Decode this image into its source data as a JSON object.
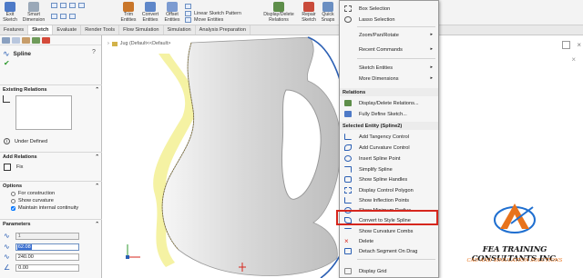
{
  "ribbon": {
    "buttons": [
      "Exit\nSketch",
      "Smart\nDimension",
      "Trim\nEntities",
      "Convert\nEntities",
      "Offset\nEntities",
      "Display/Delete\nRelations",
      "Repair\nSketch",
      "Quick\nSnaps"
    ],
    "pattern_label": "Linear Sketch Pattern",
    "move_label": "Move Entities"
  },
  "tabs": [
    "Features",
    "Sketch",
    "Evaluate",
    "Render Tools",
    "Flow Simulation",
    "Simulation",
    "Analysis Preparation"
  ],
  "active_tab": "Sketch",
  "panel": {
    "title": "Spline",
    "existing_relations": "Existing Relations",
    "under_defined": "Under Defined",
    "add_relations": "Add Relations",
    "fix": "Fix",
    "options": "Options",
    "opt_construction": "For construction",
    "opt_curvature": "Show curvature",
    "opt_continuity": "Maintain internal continuity",
    "parameters": "Parameters",
    "param_1": "1",
    "param_2": "62.08",
    "param_3": "240.00",
    "param_4": "0.00"
  },
  "canvas": {
    "breadcrumb": "Jug (Default<<Default>"
  },
  "menu": {
    "items_top": [
      {
        "label": "Box Selection",
        "submenu": false
      },
      {
        "label": "Lasso Selection",
        "submenu": false
      },
      {
        "label": "Zoom/Pan/Rotate",
        "submenu": true
      },
      {
        "label": "Recent Commands",
        "submenu": true
      },
      {
        "label": "Sketch Entities",
        "submenu": true
      },
      {
        "label": "More Dimensions",
        "submenu": true
      }
    ],
    "relations_header": "Relations",
    "relations_items": [
      "Display/Delete Relations...",
      "Fully Define Sketch..."
    ],
    "entity_header": "Selected Entity (Spline2)",
    "entity_items": [
      "Add Tangency Control",
      "Add Curvature Control",
      "Insert Spline Point",
      "Simplify Spline",
      "Show Spline Handles",
      "Display Control Polygon",
      "Show Inflection Points",
      "Show Minimum Radius",
      "Convert to Style Spline",
      "Show Curvature Combs",
      "Delete",
      "Detach Segment On Drag"
    ],
    "bottom_item": "Display Grid",
    "highlight": "Convert to Style Spline"
  },
  "logo": {
    "line1": "FEA TRAINING  CONSULTANTS INC.",
    "line2": "CAD AND SIMULATION SOLUTIONS"
  },
  "colors": {
    "accent": "#2b5fb4",
    "highlight": "#d6261d",
    "logo_orange": "#e8731c",
    "logo_blue": "#1f6fd0"
  }
}
